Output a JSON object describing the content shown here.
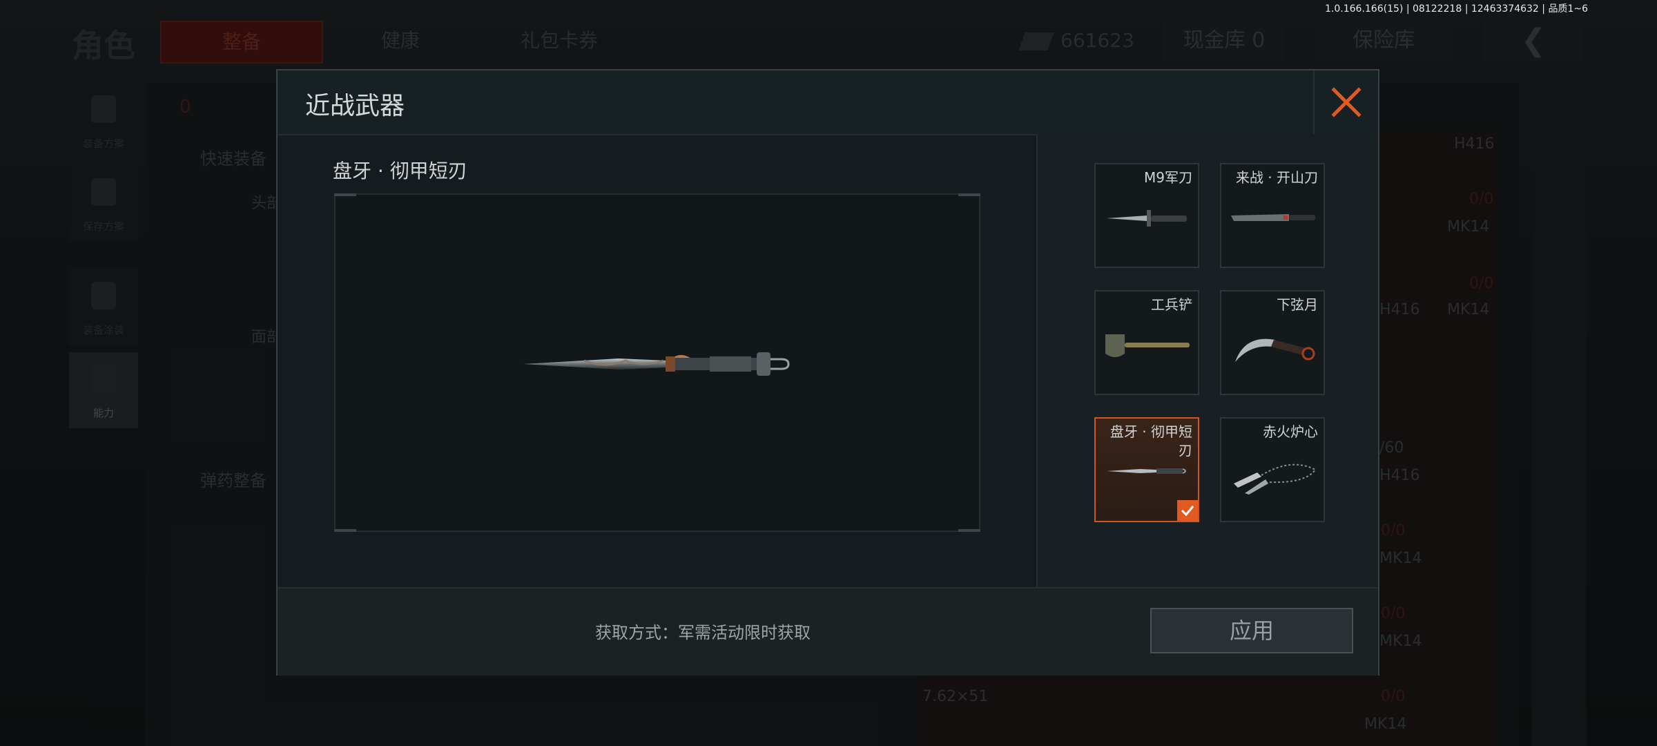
{
  "version_info": "1.0.166.166(15) | 08122218 | 12463374632 | 品质1~6",
  "background": {
    "title": "角色",
    "tabs": [
      "整备",
      "健康",
      "礼包卡券"
    ],
    "currency_value": "661623",
    "cash_vault": "现金库 0",
    "insurance_vault": "保险库",
    "back_symbol": "❮",
    "side_buttons": [
      "装备方案",
      "保存方案",
      "装备涂装",
      "能力"
    ],
    "quick_equip": "快速装备",
    "ammo_equip": "弹药整备",
    "slot_labels": [
      "头部",
      "面部"
    ],
    "weapon_names": [
      "H416",
      "MK14",
      "H416",
      "MK14",
      "H416",
      "MK14",
      "MK14",
      "MK14"
    ],
    "counts": [
      "0/0",
      "0/0",
      "0/0",
      "0/0",
      "0/0"
    ],
    "ammo_type": "7.62×51",
    "ammo_count": "/60",
    "armor_count": "0"
  },
  "modal": {
    "title": "近战武器",
    "preview_name": "盘牙 · 彻甲短刃",
    "obtain_text": "获取方式：军需活动限时获取",
    "apply_label": "应用",
    "items": [
      {
        "name": "M9军刀",
        "selected": false
      },
      {
        "name": "来战 · 开山刀",
        "selected": false
      },
      {
        "name": "工兵铲",
        "selected": false
      },
      {
        "name": "下弦月",
        "selected": false
      },
      {
        "name": "盘牙 · 彻甲短刃",
        "selected": true
      },
      {
        "name": "赤火炉心",
        "selected": false
      }
    ]
  },
  "colors": {
    "accent": "#e05a22",
    "modal_bg": "#151b1e"
  }
}
